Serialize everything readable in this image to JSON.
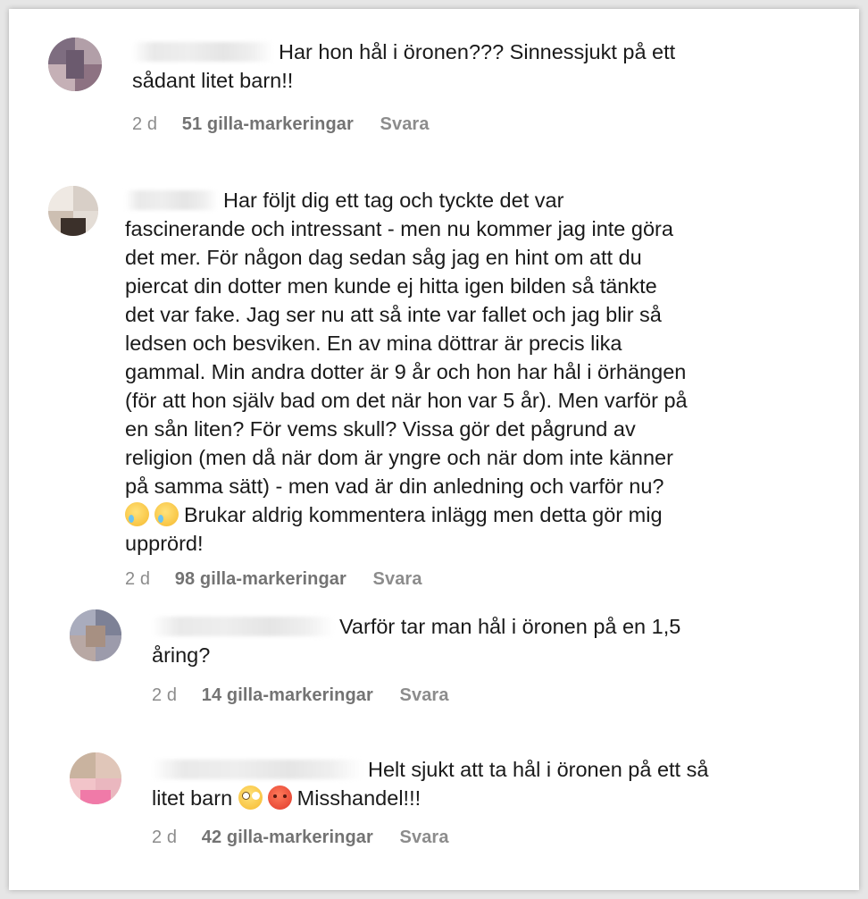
{
  "comments": [
    {
      "text": "Har hon hål i öronen??? Sinnessjukt på ett\nsådant litet barn!!",
      "time": "2 d",
      "likes": "51 gilla-markeringar",
      "reply": "Svara"
    },
    {
      "text": "Har följt dig ett tag och tyckte det var\nfascinerande och intressant - men nu kommer jag inte göra\ndet mer. För någon dag sedan såg jag en hint om att du\npiercat din dotter men kunde ej hitta igen bilden så tänkte\ndet var fake. Jag ser nu att så inte var fallet och jag blir så\nledsen och besviken. En av mina döttrar är precis lika\ngammal. Min andra dotter är 9 år och hon har hål i örhängen\n(för att hon själv bad om det när hon var 5 år). Men varför på\nen sån liten? För vems skull? Vissa gör det pågrund av\nreligion (men då när dom är yngre och när dom inte känner\npå samma sätt) - men vad är din anledning och varför nu?",
      "text_tail": "Brukar aldrig kommentera inlägg men detta gör mig\nupprörd!",
      "time": "2 d",
      "likes": "98 gilla-markeringar",
      "reply": "Svara"
    },
    {
      "text": "Varför tar man hål i öronen på en 1,5\nåring?",
      "time": "2 d",
      "likes": "14 gilla-markeringar",
      "reply": "Svara"
    },
    {
      "text_head": "Helt sjukt att ta hål i öronen på ett så\nlitet barn",
      "text_tail": "Misshandel!!!",
      "time": "2 d",
      "likes": "42 gilla-markeringar",
      "reply": "Svara"
    }
  ],
  "icons": {
    "emoji_1": "crying-face-icon",
    "emoji_2": "flushed-face-icon",
    "emoji_3": "angry-face-icon"
  }
}
